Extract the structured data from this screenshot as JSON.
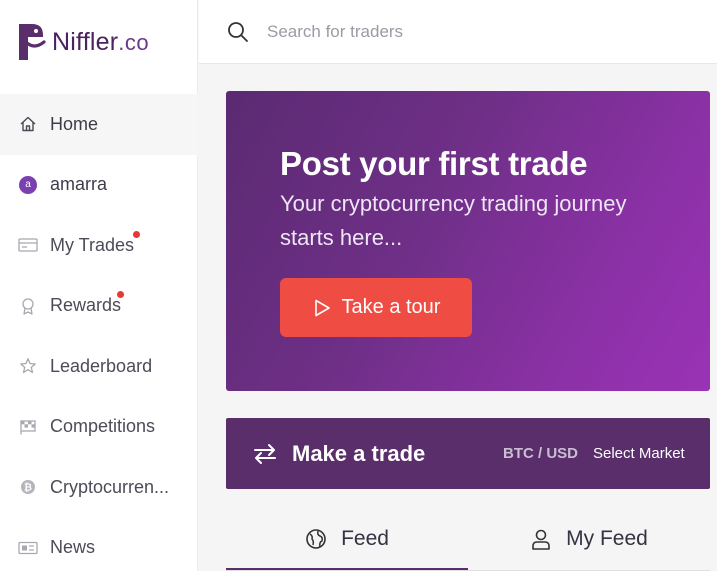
{
  "brand": {
    "name": "Niffler",
    "tld": ".co",
    "accent": "#5a2d6b"
  },
  "search": {
    "placeholder": "Search for traders"
  },
  "sidebar": {
    "items": [
      {
        "label": "Home",
        "icon": "home-icon",
        "active": true
      },
      {
        "label": "amarra",
        "icon": "avatar",
        "avatar_letter": "a"
      },
      {
        "label": "My Trades",
        "icon": "trades-icon",
        "notification": true
      },
      {
        "label": "Rewards",
        "icon": "rewards-icon",
        "notification": true
      },
      {
        "label": "Leaderboard",
        "icon": "star-icon"
      },
      {
        "label": "Competitions",
        "icon": "competitions-icon"
      },
      {
        "label": "Cryptocurren...",
        "icon": "bitcoin-icon"
      },
      {
        "label": "News",
        "icon": "news-icon"
      }
    ]
  },
  "hero": {
    "title": "Post your first trade",
    "subtitle": "Your cryptocurrency trading journey starts here...",
    "button_label": "Take a tour",
    "button_color": "#ef4c43"
  },
  "trade_bar": {
    "title": "Make a trade",
    "pair": "BTC / USD",
    "select_label": "Select Market"
  },
  "tabs": [
    {
      "label": "Feed",
      "icon": "globe-icon",
      "active": true
    },
    {
      "label": "My Feed",
      "icon": "user-icon",
      "active": false
    }
  ]
}
